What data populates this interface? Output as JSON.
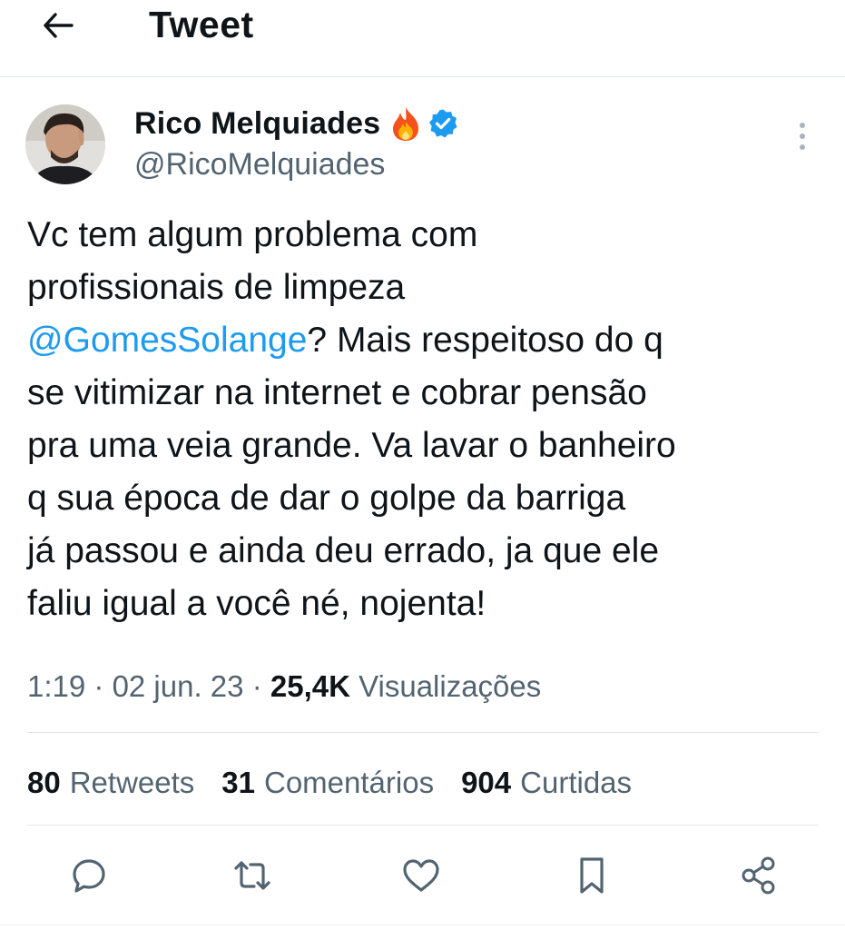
{
  "header": {
    "title": "Tweet",
    "back_icon": "arrow-left-icon"
  },
  "author": {
    "name": "Rico Melquiades",
    "name_emoji": "fire-icon",
    "verified": true,
    "verified_color": "#1d9bf0",
    "handle": "@RicoMelquiades"
  },
  "tweet": {
    "lines": [
      {
        "text": "Vc tem algum problema com"
      },
      {
        "text": "profissionais de limpeza"
      },
      {
        "mention": "@GomesSolange",
        "text": "? Mais respeitoso do q"
      },
      {
        "text": "se vitimizar na internet e cobrar pensão"
      },
      {
        "text": "pra uma veia grande. Va lavar o banheiro"
      },
      {
        "text": "q sua época de dar o golpe da barriga"
      },
      {
        "text": "já passou e ainda deu errado, ja que ele"
      },
      {
        "text": "faliu igual a você né, nojenta!"
      }
    ],
    "mention_color": "#1d9bf0"
  },
  "meta": {
    "time": "1:19",
    "separator": " · ",
    "date": "02 jun. 23",
    "views_count": "25,4K",
    "views_label": "Visualizações"
  },
  "stats": {
    "retweets_count": "80",
    "retweets_label": "Retweets",
    "comments_count": "31",
    "comments_label": "Comentários",
    "likes_count": "904",
    "likes_label": "Curtidas"
  },
  "actions": [
    {
      "icon": "reply-icon"
    },
    {
      "icon": "retweet-icon"
    },
    {
      "icon": "like-heart-icon"
    },
    {
      "icon": "bookmark-icon"
    },
    {
      "icon": "share-icon"
    }
  ],
  "colors": {
    "text": "#0f1419",
    "secondary": "#536471",
    "accent": "#1d9bf0",
    "divider": "#e3e6e9"
  }
}
